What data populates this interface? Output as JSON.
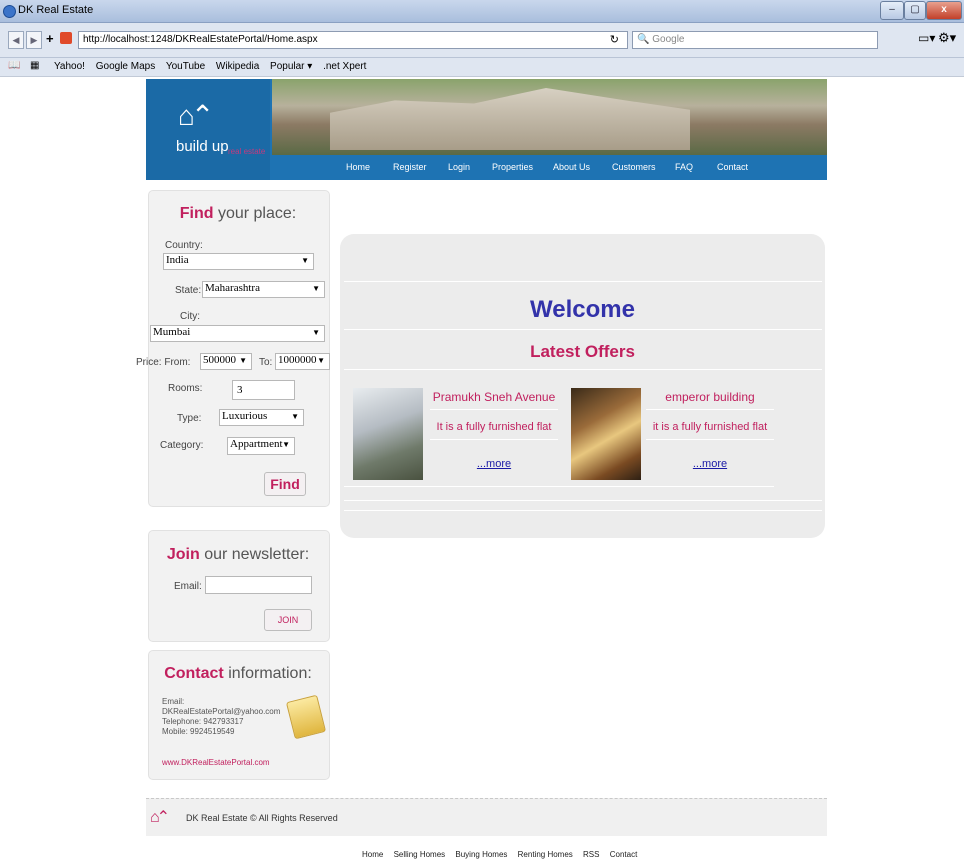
{
  "window": {
    "title": "DK Real Estate"
  },
  "browser": {
    "url": "http://localhost:1248/DKRealEstatePortal/Home.aspx",
    "search_placeholder": "Google",
    "bookmarks": [
      "Yahoo!",
      "Google Maps",
      "YouTube",
      "Wikipedia",
      "Popular ▾",
      ".net Xpert"
    ]
  },
  "logo": {
    "main": "build up",
    "sub": "real estate"
  },
  "topnav": [
    "Home",
    "Register",
    "Login",
    "Properties",
    "About Us",
    "Customers",
    "FAQ",
    "Contact"
  ],
  "find": {
    "heading_bold": "Find",
    "heading_rest": " your place:",
    "country_label": "Country:",
    "country_value": "India",
    "state_label": "State:",
    "state_value": "Maharashtra",
    "city_label": "City:",
    "city_value": "Mumbai",
    "price_from_label": "Price: From:",
    "price_from_value": "500000",
    "price_to_label": "To:",
    "price_to_value": "1000000",
    "rooms_label": "Rooms:",
    "rooms_value": "3",
    "type_label": "Type:",
    "type_value": "Luxurious",
    "category_label": "Category:",
    "category_value": "Appartment",
    "button": "Find"
  },
  "newsletter": {
    "heading_bold": "Join",
    "heading_rest": " our newsletter:",
    "email_label": "Email:",
    "button": "JOIN"
  },
  "contact": {
    "heading_bold": "Contact",
    "heading_rest": " information:",
    "email_label": "Email:",
    "email": "DKRealEstatePortal@yahoo.com",
    "telephone": "Telephone: 942793317",
    "mobile": "Mobile: 9924519549",
    "website": "www.DKRealEstatePortal.com"
  },
  "main": {
    "welcome": "Welcome",
    "latest": "Latest Offers",
    "offers": [
      {
        "title": "Pramukh Sneh Avenue",
        "desc": "It is a fully furnished flat",
        "more": "...more"
      },
      {
        "title": "emperor building",
        "desc": "it is a fully furnished flat",
        "more": "...more"
      }
    ]
  },
  "footer": {
    "copyright": "DK Real Estate © All Rights Reserved",
    "links": [
      "Home",
      "Selling Homes",
      "Buying Homes",
      "Renting Homes",
      "RSS",
      "Contact"
    ]
  },
  "colors": {
    "accent": "#c1205e",
    "header_blue": "#1e73b3",
    "welcome_blue": "#3333aa"
  }
}
